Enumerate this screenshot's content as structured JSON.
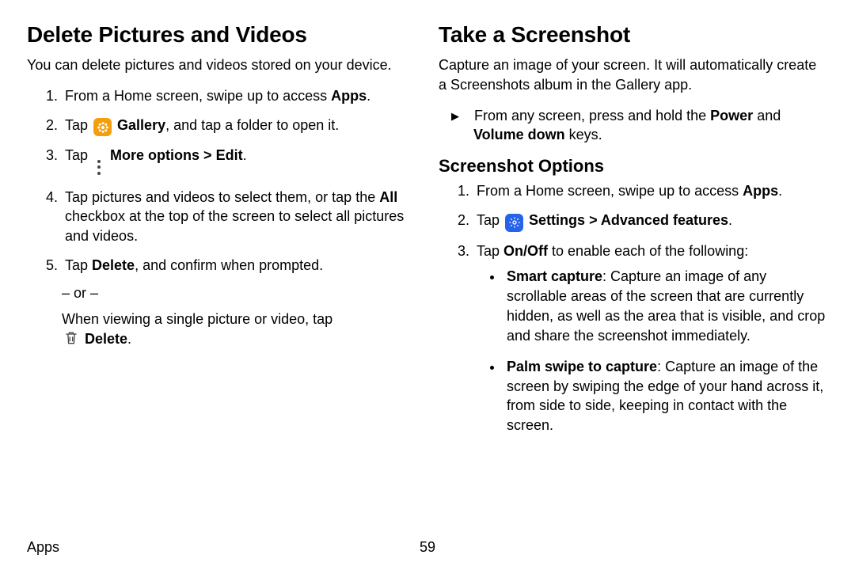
{
  "footer": {
    "section": "Apps",
    "page": "59"
  },
  "left": {
    "heading": "Delete Pictures and Videos",
    "intro": "You can delete pictures and videos stored on your device.",
    "steps": {
      "s1": {
        "pre": "From a Home screen, swipe up to access ",
        "bold": "Apps",
        "post": "."
      },
      "s2": {
        "pre": "Tap ",
        "bold": "Gallery",
        "post": ", and tap a folder to open it."
      },
      "s3": {
        "pre": "Tap ",
        "bold1": "More options",
        "sep": " > ",
        "bold2": "Edit",
        "post": "."
      },
      "s4": {
        "pre": "Tap pictures and videos to select them, or tap the ",
        "bold": "All",
        "post": " checkbox at the top of the screen to select all pictures and videos."
      },
      "s5": {
        "pre": "Tap ",
        "bold": "Delete",
        "post": ", and confirm when prompted."
      }
    },
    "or": "– or –",
    "when": {
      "pre": "When viewing a single picture or video, tap ",
      "bold": "Delete",
      "post": "."
    }
  },
  "right": {
    "heading": "Take a Screenshot",
    "intro": "Capture an image of your screen. It will automatically create a Screenshots album in the Gallery app.",
    "lead": {
      "pre": "From any screen, press and hold the ",
      "bold1": "Power",
      "mid": " and ",
      "bold2": "Volume down",
      "post": " keys."
    },
    "sub": "Screenshot Options",
    "steps": {
      "s1": {
        "pre": "From a Home screen, swipe up to access ",
        "bold": "Apps",
        "post": "."
      },
      "s2": {
        "pre": "Tap ",
        "bold1": "Settings",
        "sep": " > ",
        "bold2": "Advanced features",
        "post": "."
      },
      "s3": {
        "pre": "Tap ",
        "bold": "On/Off",
        "post": " to enable each of the following:"
      }
    },
    "bullets": {
      "b1": {
        "bold": "Smart capture",
        "post": ": Capture an image of any scrollable areas of the screen that are currently hidden, as well as the area that is visible, and crop and share the screenshot immediately."
      },
      "b2": {
        "bold": "Palm swipe to capture",
        "post": ": Capture an image of the screen by swiping the edge of your hand across it, from side to side, keeping in contact with the screen."
      }
    }
  }
}
